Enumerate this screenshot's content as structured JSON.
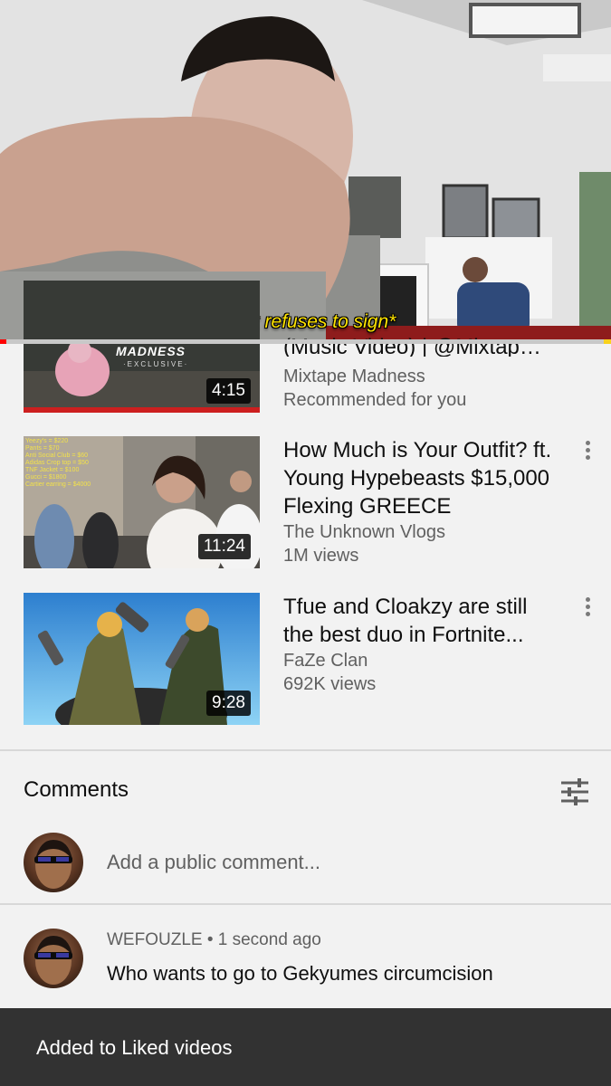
{
  "player": {
    "subtitle": "*Alex refuses to sign*",
    "progress_fraction": 0.01
  },
  "videos": [
    {
      "title": "(Music Video) | @Mixtap…",
      "channel": "Mixtape Madness",
      "meta": "Recommended for you",
      "duration": "4:15",
      "thumb_logo": "MADNESS",
      "thumb_sub": "·EXCLUSIVE·"
    },
    {
      "title": "How Much is Your Outfit? ft. Young Hypebeasts $15,000 Flexing GREECE",
      "channel": "The Unknown Vlogs",
      "meta": "1M views",
      "duration": "11:24",
      "thumb_lines": [
        "Yeezy's = $220",
        "Pants = $70",
        "Anti Social Club = $60",
        "Adidas Crop top = $50",
        "TNF Jacket = $100",
        "Gucci = $1800",
        "Cartier earring = $4000"
      ]
    },
    {
      "title": "Tfue and Cloakzy are still the best duo in Fortnite...",
      "channel": "FaZe Clan",
      "meta": "692K views",
      "duration": "9:28"
    }
  ],
  "comments": {
    "header": "Comments",
    "input_placeholder": "Add a public comment...",
    "items": [
      {
        "author": "WEFOUZLE",
        "time": "1 second ago",
        "author_line": "WEFOUZLE • 1 second ago",
        "text": "Who wants to go to Gekyumes circumcision"
      }
    ]
  },
  "snackbar": {
    "message": "Added to Liked videos"
  },
  "colors": {
    "progress": "#ff0000",
    "background": "#f2f2f2",
    "snackbar": "#323232",
    "subtitle": "#ffe400"
  }
}
